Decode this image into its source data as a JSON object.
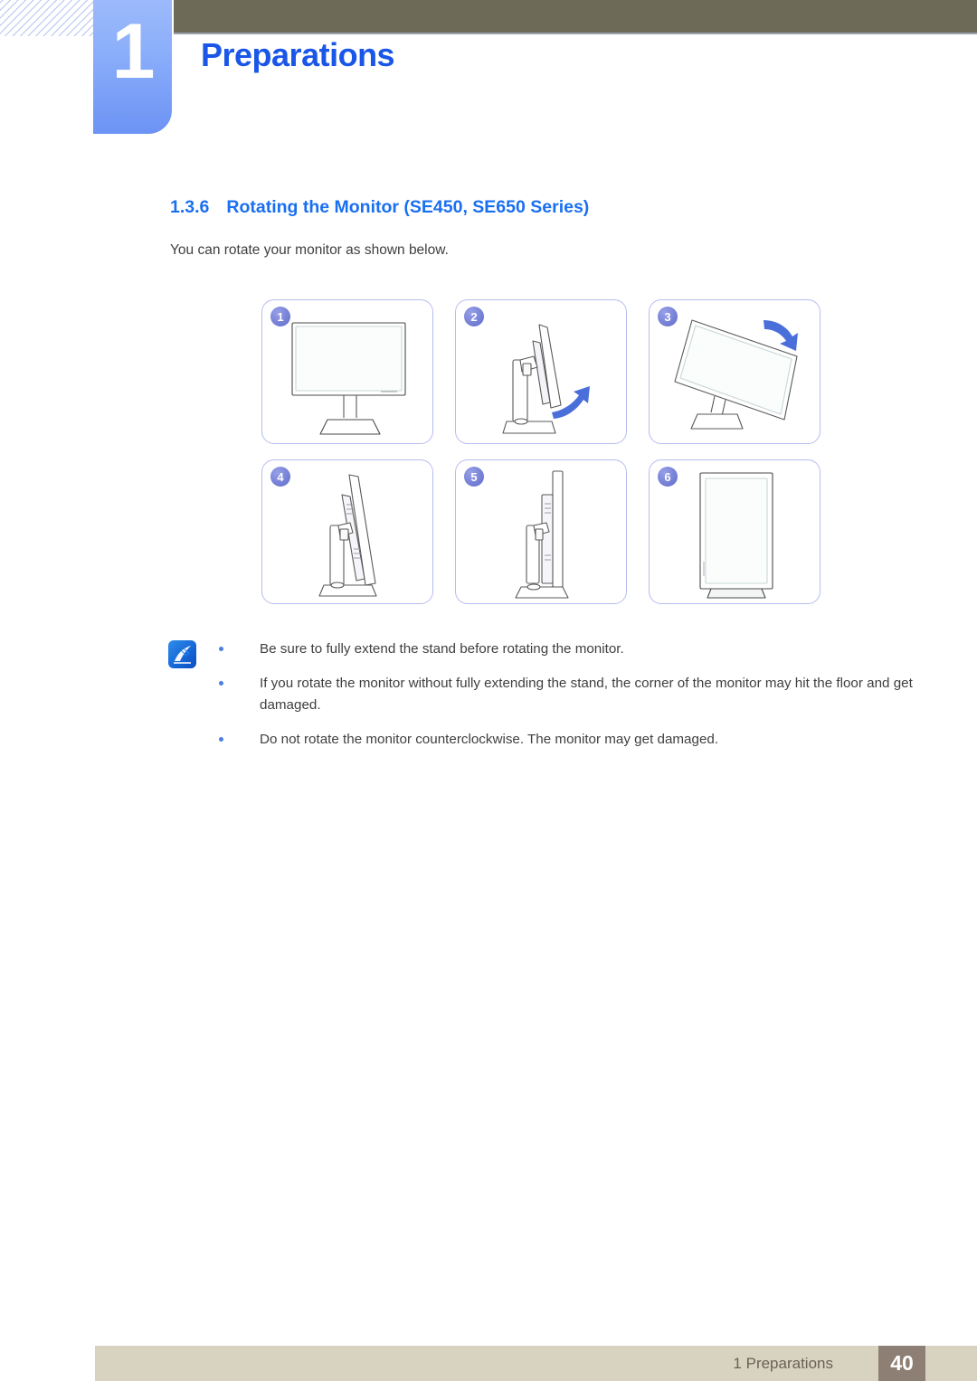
{
  "header": {
    "chapter_number": "1",
    "chapter_title": "Preparations",
    "accent_color": "#1a56e8",
    "bar_color": "#6d6a57",
    "tab_color": "#7ba2f8"
  },
  "section": {
    "number": "1.3.6",
    "title": "Rotating the Monitor (SE450, SE650 Series)",
    "heading_color": "#1a6ff0",
    "intro": "You can rotate your monitor as shown below."
  },
  "illustrations": {
    "panels": [
      {
        "badge": "1",
        "caption": "monitor-front-landscape",
        "arrow": "none"
      },
      {
        "badge": "2",
        "caption": "monitor-side-tilt",
        "arrow": "up-right"
      },
      {
        "badge": "3",
        "caption": "monitor-rotating-diagonal",
        "arrow": "down-right"
      },
      {
        "badge": "4",
        "caption": "monitor-side-rotated",
        "arrow": "none"
      },
      {
        "badge": "5",
        "caption": "monitor-side-portrait",
        "arrow": "none"
      },
      {
        "badge": "6",
        "caption": "monitor-front-portrait",
        "arrow": "none"
      }
    ],
    "border_color": "#b7bdf0",
    "badge_color": "#6f7ad2"
  },
  "note": {
    "icon": "note-quill-icon",
    "icon_color": "#1667d8",
    "bullets": [
      "Be sure to fully extend the stand before rotating the monitor.",
      "If you rotate the monitor without fully extending the stand, the corner of the monitor may hit the floor and get damaged.",
      "Do not rotate the monitor counterclockwise. The monitor may get damaged."
    ]
  },
  "footer": {
    "label": "1 Preparations",
    "page_number": "40",
    "bar_color": "#d8d3c0",
    "page_box_color": "#8e7f74"
  }
}
